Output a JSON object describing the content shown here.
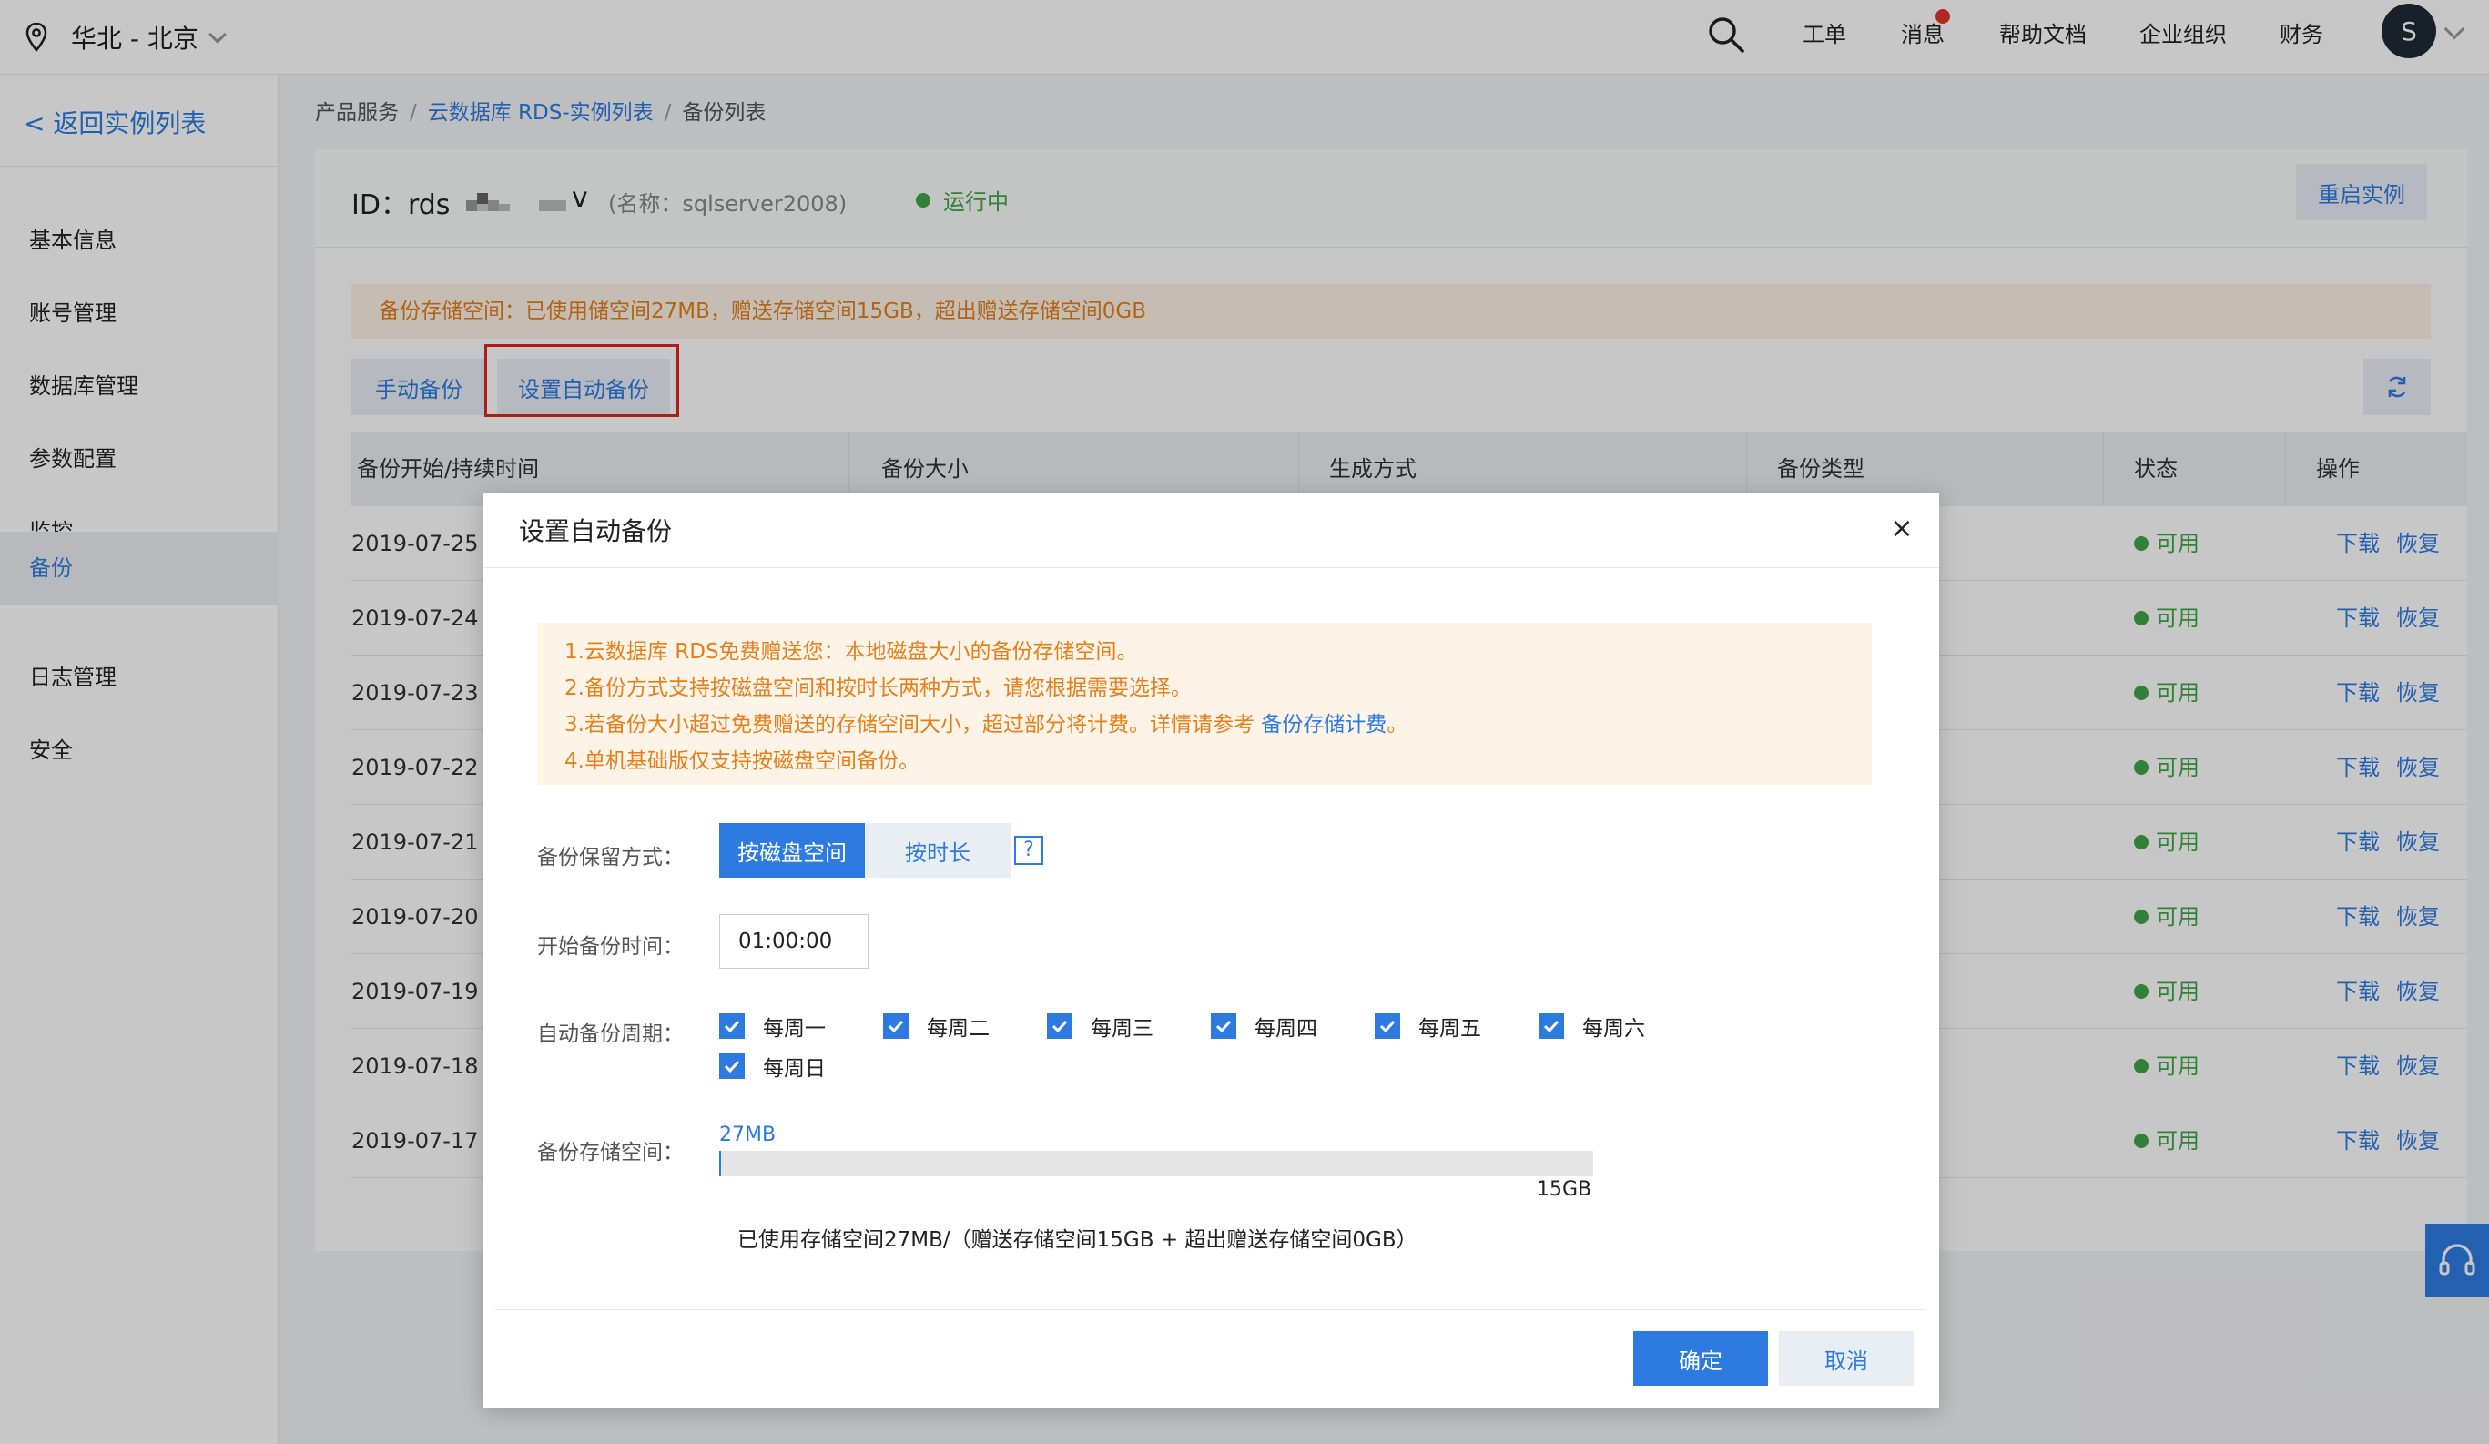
{
  "topbar": {
    "region": "华北 - 北京",
    "nav": [
      "工单",
      "消息",
      "帮助文档",
      "企业组织",
      "财务"
    ],
    "avatar_letter": "S"
  },
  "sidebar": {
    "back_label": "< 返回实例列表",
    "items": [
      "基本信息",
      "账号管理",
      "数据库管理",
      "参数配置",
      "监控",
      "备份",
      "日志管理",
      "安全"
    ],
    "active_index": 5
  },
  "breadcrumb": {
    "items": [
      "产品服务",
      "云数据库 RDS-实例列表",
      "备份列表"
    ]
  },
  "instance": {
    "id_prefix": "ID：rds",
    "id_suffix": "v",
    "name": "(名称：sqlserver2008)",
    "status": "运行中",
    "restart_label": "重启实例"
  },
  "quota": {
    "text": "备份存储空间：已使用储空间27MB，赠送存储空间15GB，超出赠送存储空间0GB"
  },
  "actions": {
    "manual_backup": "手动备份",
    "auto_backup": "设置自动备份"
  },
  "table": {
    "columns": [
      "备份开始/持续时间",
      "备份大小",
      "生成方式",
      "备份类型",
      "状态",
      "操作"
    ],
    "rows": [
      {
        "time": "2019-07-25",
        "status": "可用",
        "download": "下载",
        "restore": "恢复"
      },
      {
        "time": "2019-07-24",
        "status": "可用",
        "download": "下载",
        "restore": "恢复"
      },
      {
        "time": "2019-07-23",
        "status": "可用",
        "download": "下载",
        "restore": "恢复"
      },
      {
        "time": "2019-07-22",
        "status": "可用",
        "download": "下载",
        "restore": "恢复"
      },
      {
        "time": "2019-07-21 (",
        "status": "可用",
        "download": "下载",
        "restore": "恢复"
      },
      {
        "time": "2019-07-20",
        "status": "可用",
        "download": "下载",
        "restore": "恢复"
      },
      {
        "time": "2019-07-19 (",
        "status": "可用",
        "download": "下载",
        "restore": "恢复"
      },
      {
        "time": "2019-07-18 (",
        "status": "可用",
        "download": "下载",
        "restore": "恢复"
      },
      {
        "time": "2019-07-17 (",
        "status": "可用",
        "download": "下载",
        "restore": "恢复"
      }
    ]
  },
  "modal": {
    "title": "设置自动备份",
    "close": "×",
    "notice": [
      "1.云数据库 RDS免费赠送您：本地磁盘大小的备份存储空间。",
      "2.备份方式支持按磁盘空间和按时长两种方式，请您根据需要选择。",
      "3.若备份大小超过免费赠送的存储空间大小，超过部分将计费。详情请参考 ",
      "4.单机基础版仅支持按磁盘空间备份。"
    ],
    "notice_link": "备份存储计费",
    "notice_link_tail": "。",
    "retention_label": "备份保留方式：",
    "retention_options": [
      "按磁盘空间",
      "按时长"
    ],
    "retention_selected": "按磁盘空间",
    "help_mark": "?",
    "start_time_label": "开始备份时间：",
    "start_time_value": "01:00:00",
    "period_label": "自动备份周期：",
    "period_days": [
      "每周一",
      "每周二",
      "每周三",
      "每周四",
      "每周五",
      "每周六",
      "每周日"
    ],
    "storage_label": "备份存储空间：",
    "storage_used": "27MB",
    "storage_total": "15GB",
    "storage_fraction": 0.0018,
    "storage_summary": "已使用存储空间27MB/（赠送存储空间15GB + 超出赠送存储空间0GB）",
    "ok_label": "确定",
    "cancel_label": "取消"
  },
  "colors": {
    "accent": "#2d7be0",
    "success": "#3fa647",
    "warning": "#e57f1b",
    "warning_bg": "#fdf3e7",
    "highlight_border": "#e02424"
  }
}
